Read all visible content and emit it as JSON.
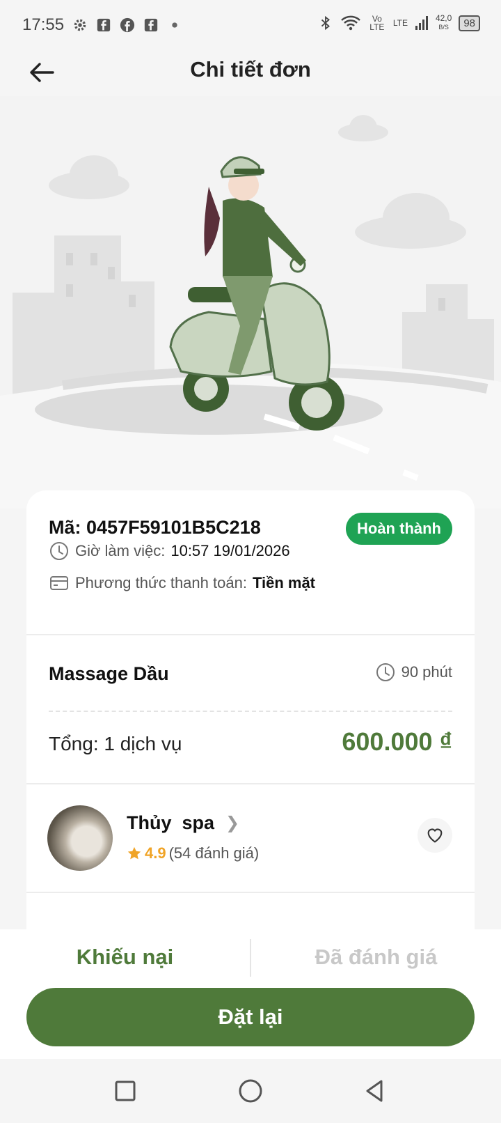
{
  "status_bar": {
    "time": "17:55",
    "network_speed": "42,0",
    "network_speed_unit": "B/S",
    "network_type": "LTE",
    "volte": "Vo LTE",
    "battery": "98",
    "icons": [
      "gear-icon",
      "facebook-square-icon",
      "facebook-circle-icon",
      "facebook-square-icon",
      "dot-icon",
      "bluetooth-icon",
      "wifi-icon",
      "signal-icon"
    ]
  },
  "header": {
    "title": "Chi tiết đơn",
    "back_icon": "arrow-left-icon"
  },
  "order": {
    "code_label": "Mã:",
    "code": "0457F59101B5C218",
    "status": "Hoàn thành",
    "status_color": "#1fa354",
    "work_time_label": "Giờ làm việc:",
    "work_time": "10:57 19/01/2026",
    "payment_label": "Phương thức thanh toán:",
    "payment": "Tiền mặt"
  },
  "service": {
    "name": "Massage Dầu",
    "duration": "90 phút",
    "total_label": "Tổng: 1 dịch vụ",
    "total": "600.000 ₫"
  },
  "shop": {
    "name": "Thủy  spa",
    "rating": "4.9",
    "reviews": "(54 đánh giá)"
  },
  "actions": {
    "complain": "Khiếu nại",
    "rated": "Đã đánh giá",
    "rebook": "Đặt lại"
  },
  "colors": {
    "primary": "#4f7a3a",
    "success": "#1fa354",
    "star": "#f0a427"
  }
}
